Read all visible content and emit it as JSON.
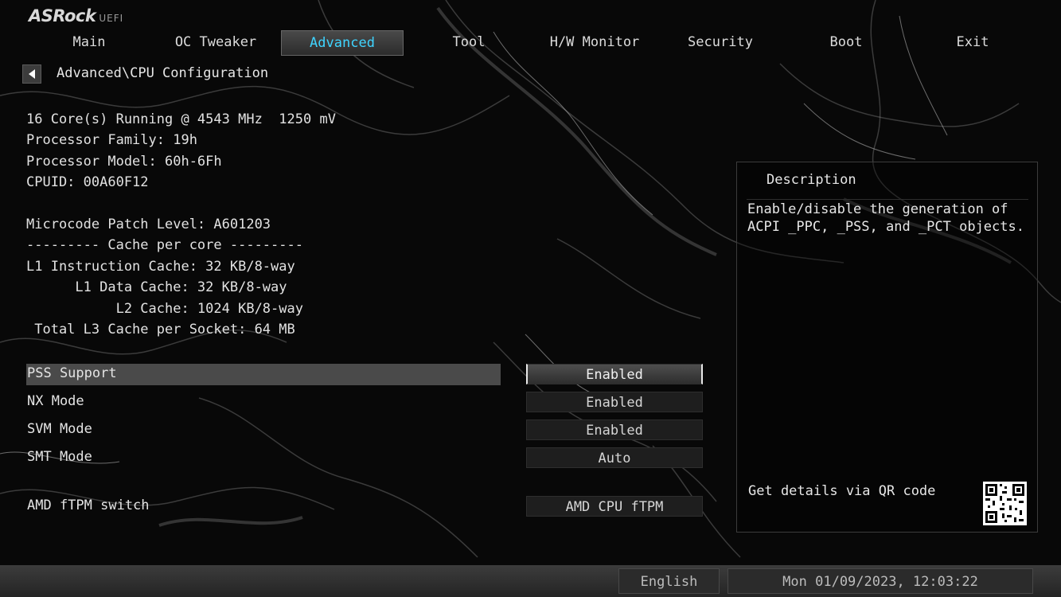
{
  "brand": {
    "name": "ASRock",
    "sub": "UEFI"
  },
  "tabs": [
    {
      "label": "Main"
    },
    {
      "label": "OC Tweaker"
    },
    {
      "label": "Advanced"
    },
    {
      "label": "Tool"
    },
    {
      "label": "H/W Monitor"
    },
    {
      "label": "Security"
    },
    {
      "label": "Boot"
    },
    {
      "label": "Exit"
    }
  ],
  "active_tab": "Advanced",
  "breadcrumb": "Advanced\\CPU Configuration",
  "info": {
    "running": "16 Core(s) Running @ 4543 MHz  1250 mV",
    "family": "Processor Family: 19h",
    "model": "Processor Model: 60h-6Fh",
    "cpuid": "CPUID: 00A60F12",
    "microcode": "Microcode Patch Level: A601203",
    "cache_header": "--------- Cache per core ---------",
    "l1i": "L1 Instruction Cache: 32 KB/8-way",
    "l1d": "      L1 Data Cache: 32 KB/8-way",
    "l2": "           L2 Cache: 1024 KB/8-way",
    "l3": " Total L3 Cache per Socket: 64 MB"
  },
  "settings": [
    {
      "label": "PSS Support",
      "value": "Enabled"
    },
    {
      "label": "NX Mode",
      "value": "Enabled"
    },
    {
      "label": "SVM Mode",
      "value": "Enabled"
    },
    {
      "label": "SMT Mode",
      "value": "Auto"
    },
    {
      "label": "AMD fTPM switch",
      "value": "AMD CPU fTPM"
    }
  ],
  "description": {
    "title": "Description",
    "text": "Enable/disable the generation of ACPI _PPC, _PSS, and _PCT objects.",
    "qr_label": "Get details via QR code"
  },
  "footer": {
    "language": "English",
    "datetime": "Mon 01/09/2023, 12:03:22"
  },
  "colors": {
    "active_tab": "#3fd4ff",
    "highlight": "#4a4a4a"
  }
}
